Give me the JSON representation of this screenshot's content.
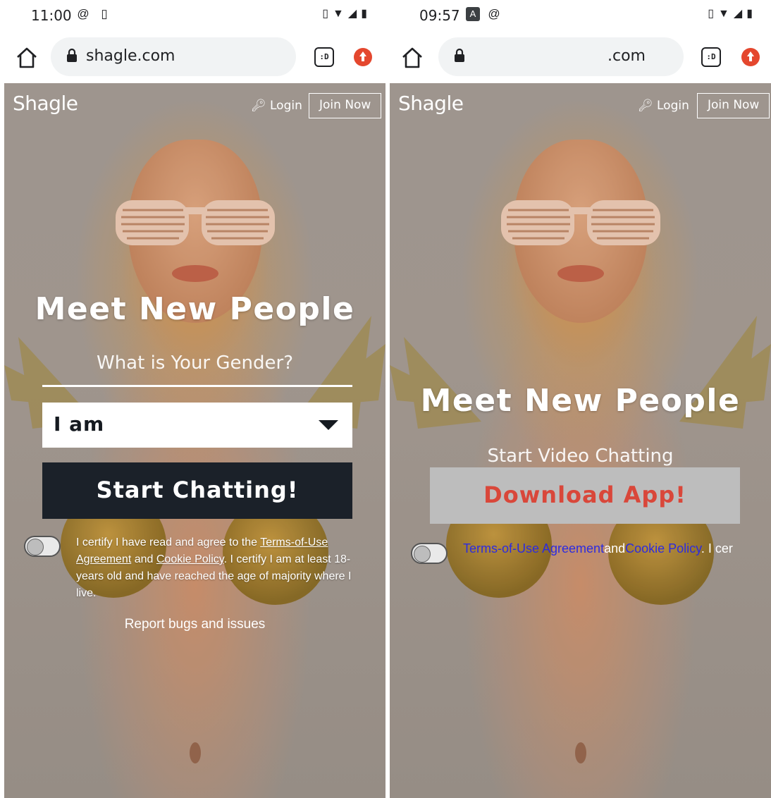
{
  "left": {
    "status": {
      "time": "11:00"
    },
    "browser": {
      "url": "shagle.com",
      "tabs_count": ":D"
    },
    "site": {
      "logo": "Shagle",
      "login": "Login",
      "join": "Join Now",
      "headline": "Meet New People",
      "gender_prompt": "What is Your Gender?",
      "select_value": "I am",
      "start_button": "Start Chatting!",
      "certify_prefix": "I certify I have read and agree to the ",
      "terms_link": "Terms-of-Use Agreement",
      "and": " and ",
      "cookie_link": "Cookie Policy",
      "certify_suffix": ". I certify I am at least 18-years old and have reached the age of majority where I live.",
      "report": "Report bugs and issues"
    }
  },
  "right": {
    "status": {
      "time": "09:57"
    },
    "browser": {
      "url": ".com",
      "tabs_count": ":D"
    },
    "site": {
      "logo": "Shagle",
      "login": "Login",
      "join": "Join Now",
      "headline": "Meet New People",
      "subline": "Start Video Chatting",
      "download_button": "Download App!",
      "terms_link": "Terms-of-Use Agreement",
      "and": "and",
      "cookie_link": "Cookie Policy",
      "tail": ". I cer"
    }
  },
  "colors": {
    "start_button_bg": "#1b2129",
    "download_button_bg": "#bdbdbd",
    "download_button_text": "#d9473a",
    "link_blue": "#2c2be0",
    "extension_red": "#e4472e"
  }
}
